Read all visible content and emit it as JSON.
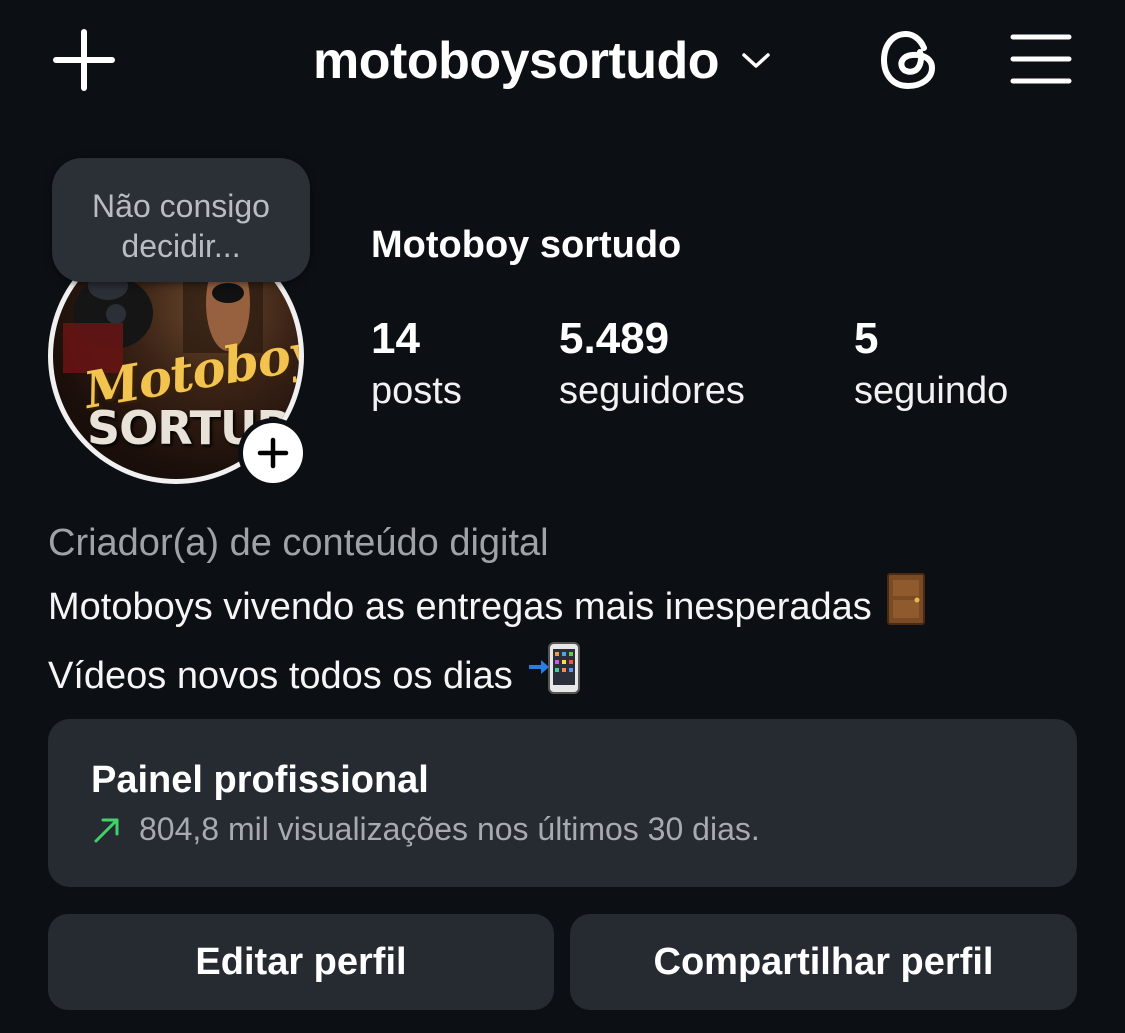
{
  "header": {
    "username": "motoboysortudo",
    "icons": {
      "create": "plus-icon",
      "account_switch": "chevron-down-icon",
      "threads": "threads-icon",
      "menu": "hamburger-menu-icon"
    }
  },
  "profile": {
    "note": "Não consigo\ndecidir...",
    "avatar_text_line1": "Motoboy",
    "avatar_text_line2": "SORTUDO",
    "display_name": "Motoboy sortudo",
    "stats": [
      {
        "value": "14",
        "label": "posts"
      },
      {
        "value": "5.489",
        "label": "seguidores"
      },
      {
        "value": "5",
        "label": "seguindo"
      }
    ],
    "category": "Criador(a) de conteúdo digital",
    "bio_line1": "Motoboys vivendo as entregas mais inesperadas",
    "bio_line1_emoji": "door-emoji",
    "bio_line2": "Vídeos novos todos os dias",
    "bio_line2_emoji": "mobile-phone-with-arrow-emoji"
  },
  "professional_dashboard": {
    "title": "Painel profissional",
    "summary": "804,8 mil visualizações nos últimos 30 dias.",
    "trend_icon": "trend-up-arrow-icon",
    "trend_color": "#3fd26a"
  },
  "actions": {
    "edit_profile": "Editar perfil",
    "share_profile": "Compartilhar perfil"
  },
  "colors": {
    "background": "#0c0f14",
    "card": "#262a31",
    "muted_text": "#9fa3a8"
  }
}
